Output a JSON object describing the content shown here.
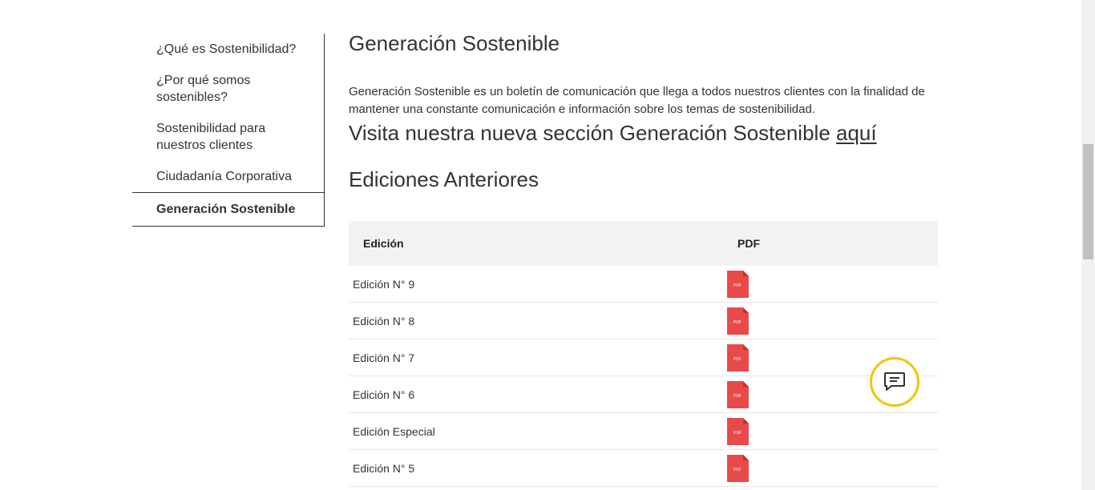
{
  "sidebar": {
    "items": [
      {
        "label": "¿Qué es Sostenibilidad?"
      },
      {
        "label": "¿Por qué somos sostenibles?"
      },
      {
        "label": "Sostenibilidad para nuestros clientes"
      },
      {
        "label": "Ciudadanía Corporativa"
      },
      {
        "label": "Generación Sostenible",
        "active": true
      }
    ]
  },
  "main": {
    "title": "Generación Sostenible",
    "intro": "Generación Sostenible es un boletín de comunicación que llega a todos nuestros clientes con la finalidad de mantener una constante comunicación e información sobre los temas de sostenibilidad.",
    "visit_text": "Visita nuestra nueva sección Generación Sostenible ",
    "visit_link": "aquí",
    "section_title": "Ediciones Anteriores"
  },
  "table": {
    "headers": {
      "edition": "Edición",
      "pdf": "PDF"
    },
    "rows": [
      {
        "edition": "Edición N° 9",
        "icon": "pdf-file-icon"
      },
      {
        "edition": "Edición N° 8",
        "icon": "pdf-file-icon"
      },
      {
        "edition": "Edición N° 7",
        "icon": "pdf-file-icon"
      },
      {
        "edition": "Edición N° 6",
        "icon": "pdf-file-icon"
      },
      {
        "edition": "Edición Especial",
        "icon": "pdf-file-icon"
      },
      {
        "edition": "Edición N° 5",
        "icon": "pdf-file-icon"
      }
    ],
    "pdf_icon_text": "PDF"
  },
  "chat": {
    "icon": "chat-icon"
  },
  "colors": {
    "pdf_red": "#e84a4a",
    "chat_ring": "#f2c500",
    "header_bg": "#f2f2f2"
  }
}
